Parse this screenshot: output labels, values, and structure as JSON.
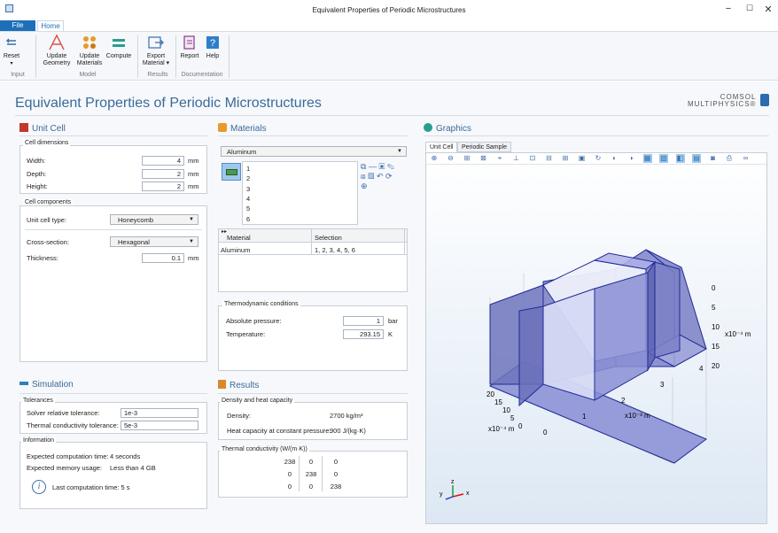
{
  "window": {
    "title": "Equivalent Properties of Periodic Microstructures",
    "minimize": "−",
    "maximize": "☐",
    "close": "✕"
  },
  "menu_tabs": {
    "file": "File",
    "home": "Home"
  },
  "ribbon": {
    "reset": "Reset",
    "update_geometry": "Update Geometry",
    "update_materials": "Update Materials",
    "compute": "Compute",
    "export_material": "Export Material ▾",
    "report": "Report",
    "help": "Help",
    "groups": {
      "input": "Input",
      "model": "Model",
      "results": "Results",
      "documentation": "Documentation"
    }
  },
  "app": {
    "title": "Equivalent Properties of Periodic Microstructures",
    "logo_line1": "COMSOL",
    "logo_line2": "MULTIPHYSICS®"
  },
  "unit_cell": {
    "title": "Unit Cell",
    "dims_group": "Cell dimensions",
    "width_label": "Width:",
    "width_value": "4",
    "width_unit": "mm",
    "depth_label": "Depth:",
    "depth_value": "2",
    "depth_unit": "mm",
    "height_label": "Height:",
    "height_value": "2",
    "height_unit": "mm",
    "comp_group": "Cell components",
    "type_label": "Unit cell type:",
    "type_value": "Honeycomb",
    "cross_label": "Cross-section:",
    "cross_value": "Hexagonal",
    "thick_label": "Thickness:",
    "thick_value": "0.1",
    "thick_unit": "mm"
  },
  "materials": {
    "title": "Materials",
    "selected": "Aluminum",
    "domains": [
      "1",
      "2",
      "3",
      "4",
      "5",
      "6"
    ],
    "table_headers": [
      "Material",
      "Selection"
    ],
    "table_rows": [
      [
        "Aluminum",
        "1, 2, 3, 4, 5, 6"
      ]
    ],
    "thermo_group": "Thermodynamic conditions",
    "pressure_label": "Absolute pressure:",
    "pressure_value": "1",
    "pressure_unit": "bar",
    "temp_label": "Temperature:",
    "temp_value": "293.15",
    "temp_unit": "K"
  },
  "simulation": {
    "title": "Simulation",
    "tol_group": "Tolerances",
    "solver_label": "Solver relative tolerance:",
    "solver_value": "1e-3",
    "thermal_label": "Thermal conductivity tolerance:",
    "thermal_value": "5e-3",
    "info_group": "Information",
    "exp_time_label": "Expected computation time:",
    "exp_time_value": "4 seconds",
    "exp_mem_label": "Expected memory usage:",
    "exp_mem_value": "Less than 4 GB",
    "last_time": "Last computation time: 5 s"
  },
  "results": {
    "title": "Results",
    "dens_group": "Density and heat capacity",
    "density_label": "Density:",
    "density_value": "2700 kg/m³",
    "heat_label": "Heat capacity at constant pressure:",
    "heat_value": "900 J/(kg·K)",
    "tc_group": "Thermal conductivity (W/(m·K))",
    "matrix": [
      [
        "238",
        "0",
        "0"
      ],
      [
        "0",
        "238",
        "0"
      ],
      [
        "0",
        "0",
        "238"
      ]
    ]
  },
  "graphics": {
    "title": "Graphics",
    "tabs": [
      "Unit Cell",
      "Periodic Sample"
    ],
    "z_ticks": [
      "20",
      "15",
      "10",
      "5",
      "0"
    ],
    "z_unit": "x10⁻⁴ m",
    "y_ticks": [
      "20",
      "15",
      "10",
      "5",
      "0"
    ],
    "y_unit": "x10⁻⁴ m",
    "x_ticks": [
      "0",
      "1",
      "2",
      "3",
      "4"
    ],
    "x_unit": "x10⁻³ m",
    "triad_x": "x",
    "triad_y": "y",
    "triad_z": "z"
  },
  "colors": {
    "accent": "#3a6a9a",
    "file_tab": "#1e6fba",
    "shape": "#7a7fc4"
  }
}
